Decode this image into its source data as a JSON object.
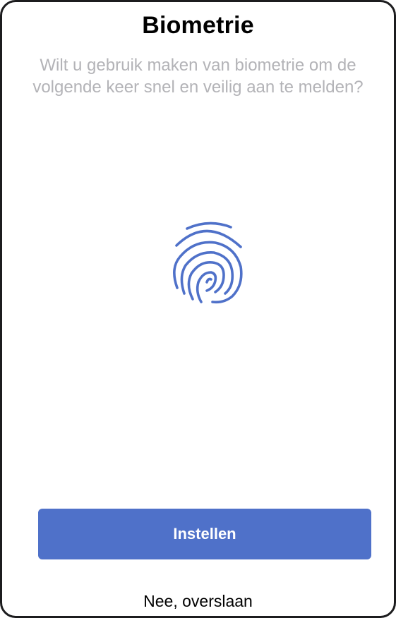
{
  "screen": {
    "title": "Biometrie",
    "subtitle": "Wilt u gebruik maken van biometrie om de volgende keer snel en veilig aan te melden?",
    "icon": "fingerprint-icon"
  },
  "actions": {
    "primary_label": "Instellen",
    "secondary_label": "Nee, overslaan"
  },
  "colors": {
    "accent": "#4f71c9",
    "subtitle_text": "#b3b3b7",
    "title_text": "#000000"
  }
}
